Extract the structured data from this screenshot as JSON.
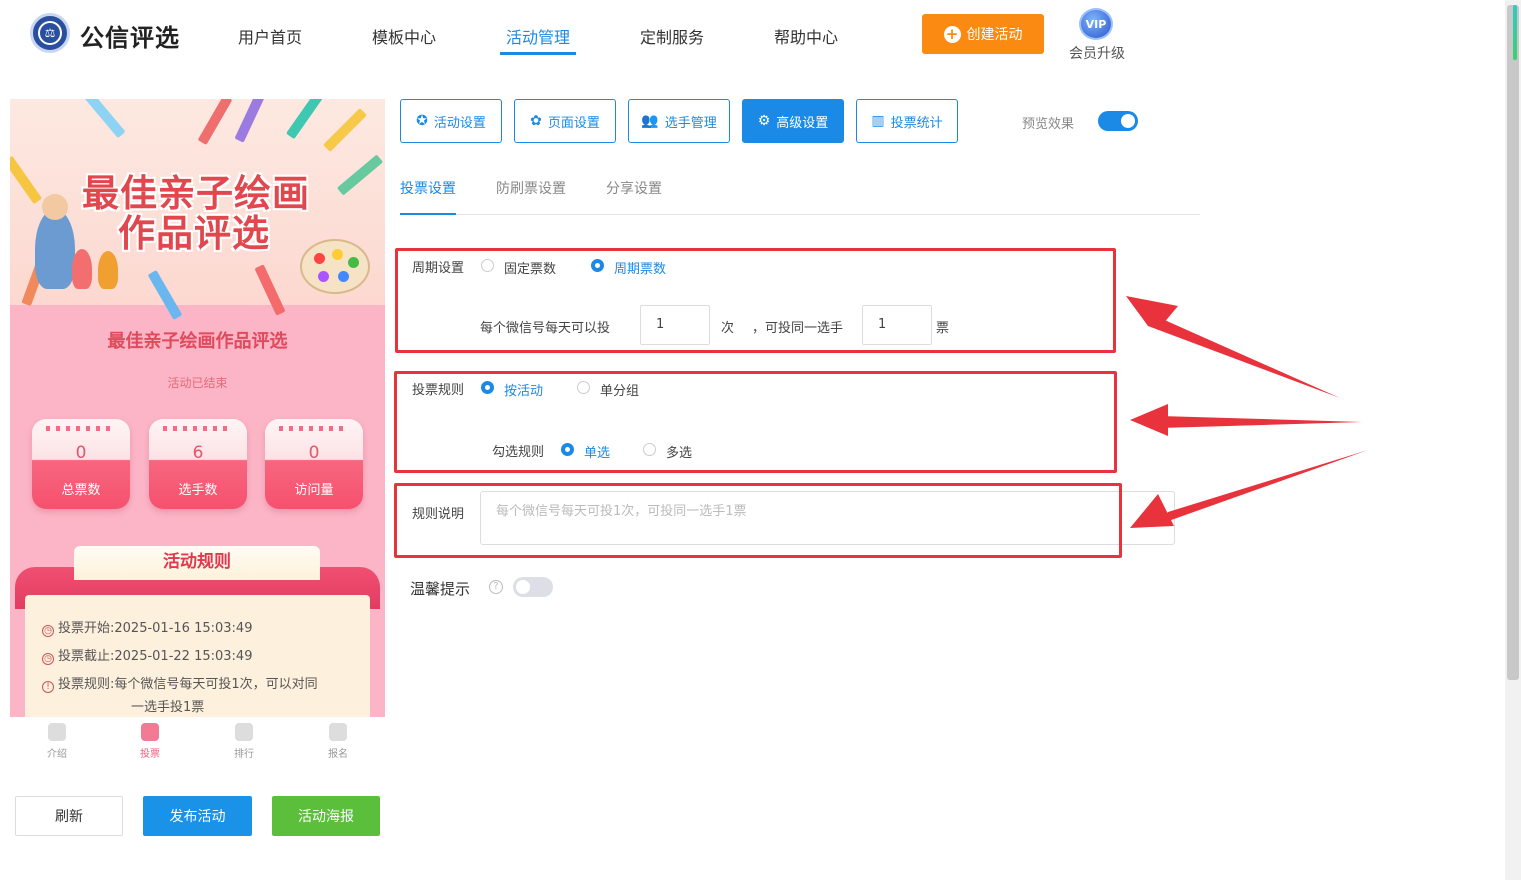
{
  "header": {
    "brand": "公信评选",
    "nav": [
      "用户首页",
      "模板中心",
      "活动管理",
      "定制服务",
      "帮助中心"
    ],
    "active_nav": "活动管理",
    "create_button": "创建活动",
    "vip_badge": "VIP",
    "vip_label": "会员升级"
  },
  "preview": {
    "banner_line1": "最佳亲子绘画",
    "banner_line2": "作品评选",
    "title": "最佳亲子绘画作品评选",
    "status": "活动已结束",
    "stats": [
      {
        "value": "0",
        "label": "总票数"
      },
      {
        "value": "6",
        "label": "选手数"
      },
      {
        "value": "0",
        "label": "访问量"
      }
    ],
    "rules_tab": "活动规则",
    "rules": {
      "start_label": "投票开始:",
      "start_value": "2025-01-16 15:03:49",
      "end_label": "投票截止:",
      "end_value": "2025-01-22 15:03:49",
      "rule_label": "投票规则:",
      "rule_value_line1": "每个微信号每天可投1次，可以对同",
      "rule_value_line2": "一选手投1票"
    },
    "bottom_tabs": [
      "介绍",
      "投票",
      "排行",
      "报名"
    ],
    "active_tab": "投票"
  },
  "actions": {
    "refresh": "刷新",
    "publish": "发布活动",
    "poster": "活动海报"
  },
  "toolbar": {
    "buttons": [
      "活动设置",
      "页面设置",
      "选手管理",
      "高级设置",
      "投票统计"
    ],
    "active": "高级设置",
    "preview_label": "预览效果",
    "preview_on": true
  },
  "subtabs": [
    "投票设置",
    "防刷票设置",
    "分享设置"
  ],
  "active_subtab": "投票设置",
  "cycle": {
    "label": "周期设置",
    "options": [
      "固定票数",
      "周期票数"
    ],
    "selected": "周期票数",
    "text_before": "每个微信号每天可以投",
    "times_value": "1",
    "times_unit": "次",
    "text_middle": "，可投同一选手",
    "votes_value": "1",
    "votes_unit": "票"
  },
  "vote_rule": {
    "label": "投票规则",
    "options": [
      "按活动",
      "单分组"
    ],
    "selected": "按活动",
    "check_label": "勾选规则",
    "check_options": [
      "单选",
      "多选"
    ],
    "check_selected": "单选"
  },
  "rule_desc": {
    "label": "规则说明",
    "placeholder": "每个微信号每天可投1次，可投同一选手1票"
  },
  "warm_tip": {
    "label": "温馨提示",
    "enabled": false
  },
  "colors": {
    "primary": "#1a8ae6",
    "orange": "#fa8a12",
    "green": "#5cbf3c",
    "highlight": "#e8323c"
  }
}
